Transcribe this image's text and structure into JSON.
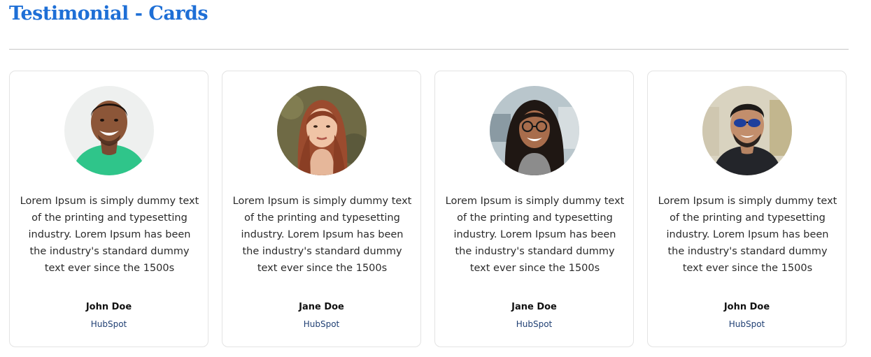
{
  "page": {
    "title": "Testimonial - Cards",
    "accent_color": "#1e6fd6"
  },
  "testimonials": [
    {
      "quote": "Lorem Ipsum is simply dummy text of the printing and typesetting industry. Lorem Ipsum has been the industry's standard dummy text ever since the 1500s",
      "name": "John Doe",
      "company": "HubSpot",
      "avatar": "man-green-shirt-portrait"
    },
    {
      "quote": "Lorem Ipsum is simply dummy text of the printing and typesetting industry. Lorem Ipsum has been the industry's standard dummy text ever since the 1500s",
      "name": "Jane Doe",
      "company": "HubSpot",
      "avatar": "woman-long-red-hair-portrait"
    },
    {
      "quote": "Lorem Ipsum is simply dummy text of the printing and typesetting industry. Lorem Ipsum has been the industry's standard dummy text ever since the 1500s",
      "name": "Jane Doe",
      "company": "HubSpot",
      "avatar": "woman-glasses-portrait"
    },
    {
      "quote": "Lorem Ipsum is simply dummy text of the printing and typesetting industry. Lorem Ipsum has been the industry's standard dummy text ever since the 1500s",
      "name": "John Doe",
      "company": "HubSpot",
      "avatar": "man-sunglasses-portrait"
    }
  ]
}
